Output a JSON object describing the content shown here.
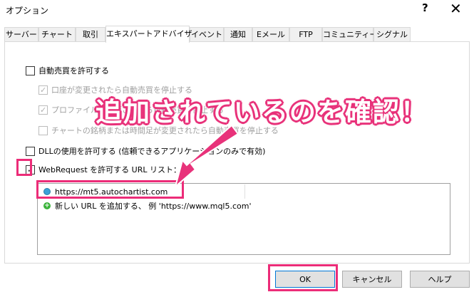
{
  "window": {
    "title": "オプション",
    "help_glyph": "?",
    "close_glyph": "✕"
  },
  "tabs": [
    {
      "label": "サーバー",
      "active": false
    },
    {
      "label": "チャート",
      "active": false
    },
    {
      "label": "取引",
      "active": false
    },
    {
      "label": "エキスパートアドバイザ",
      "active": true
    },
    {
      "label": "イベント",
      "active": false
    },
    {
      "label": "通知",
      "active": false
    },
    {
      "label": "Eメール",
      "active": false
    },
    {
      "label": "FTP",
      "active": false
    },
    {
      "label": "コミュニティー",
      "active": false
    },
    {
      "label": "シグナル",
      "active": false
    }
  ],
  "options": {
    "auto_trading": {
      "label": "自動売買を許可する",
      "checked": false
    },
    "disable_on_account_change": {
      "label": "口座が変更されたら自動売買を停止する",
      "checked": true,
      "enabled": false
    },
    "disable_on_profile_change": {
      "label": "プロファイルが変更されたら自動売買を停止する",
      "checked": true,
      "enabled": false
    },
    "disable_on_chart_change": {
      "label": "チャートの銘柄または時間足が変更されたら自動売買を停止する",
      "checked": false,
      "enabled": false
    },
    "allow_dll": {
      "label": "DLLの使用を許可する (信頼できるアプリケーションのみで有効)",
      "checked": false
    },
    "allow_webrequest": {
      "label": "WebRequest を許可する URL リスト：",
      "checked": true
    }
  },
  "url_list": {
    "entries": [
      "https://mt5.autochartist.com"
    ],
    "add_hint": "新しい URL を追加する、 例 'https://www.mql5.com'"
  },
  "buttons": {
    "ok": "OK",
    "cancel": "キャンセル",
    "help": "ヘルプ"
  },
  "annotation": {
    "text": "追加されているのを確認！",
    "color": "#e8327a"
  },
  "colors": {
    "highlight": "#ec2c78",
    "default_button_border": "#0078d7"
  }
}
